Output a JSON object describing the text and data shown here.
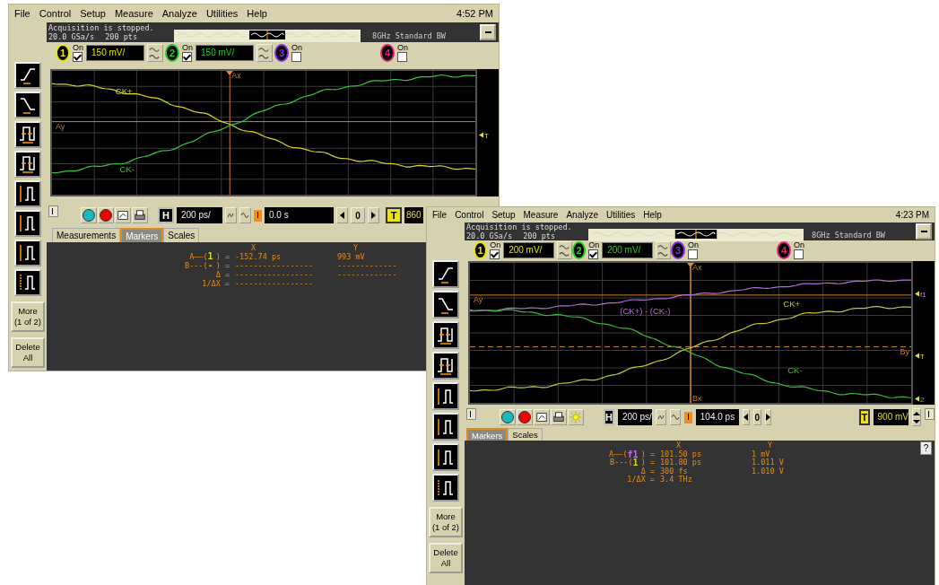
{
  "windows": [
    {
      "menu": [
        "File",
        "Control",
        "Setup",
        "Measure",
        "Analyze",
        "Utilities",
        "Help"
      ],
      "clock": "4:52 PM",
      "status": {
        "message": "Acquisition is stopped.",
        "rate": "20.0 GSa/s",
        "points": "200 pts",
        "bandwidth": "8GHz Standard BW"
      },
      "channels": [
        {
          "number": "1",
          "color": "#e6e600",
          "on_label": "On",
          "checked": true,
          "scale": "150 mV/"
        },
        {
          "number": "2",
          "color": "#22cc22",
          "on_label": "On",
          "checked": true,
          "scale": "150 mV/"
        },
        {
          "number": "3",
          "color": "#8a2be2",
          "on_label": "On",
          "checked": false
        },
        {
          "number": "4",
          "color": "#e0207a",
          "on_label": "On",
          "checked": false
        }
      ],
      "sidebar": {
        "more": "More (1 of 2)",
        "delete": "Delete All"
      },
      "plot": {
        "traces": [
          {
            "label": "CK+",
            "color": "#d8d820"
          },
          {
            "label": "CK-",
            "color": "#3cc83c"
          }
        ],
        "cursors": [
          {
            "label": "Ax",
            "kind": "ax"
          },
          {
            "label": "Ay",
            "kind": "ay"
          }
        ],
        "edge_labels": [
          {
            "text": "T",
            "kind": "trigger"
          }
        ]
      },
      "toolbar": {
        "tools": [
          {
            "kind": "run"
          },
          {
            "kind": "stop"
          },
          {
            "kind": "image"
          },
          {
            "kind": "print"
          }
        ],
        "horizontal": "H",
        "timebase": "200 ps/",
        "delay": "0.0 s",
        "reference": "0",
        "trigger": "T",
        "trigger_level": "860"
      },
      "tabs": [
        {
          "label": "Measurements",
          "selected": false
        },
        {
          "label": "Markers",
          "selected": true
        },
        {
          "label": "Scales",
          "selected": false
        }
      ],
      "readout": {
        "x_header": "X",
        "y_header": "Y",
        "rows": [
          {
            "prefix": "A——(",
            "source": "1",
            "suffix": ") =",
            "color": "#d8d820",
            "x": "-152.74 ps",
            "y": "993 mV"
          },
          {
            "prefix": "B---(",
            "source": "-",
            "suffix": ") =",
            "x": "-----------------",
            "y": "-------------"
          },
          {
            "prefix": "Δ =",
            "x": "-----------------",
            "y": "-------------"
          },
          {
            "prefix": "1/ΔX =",
            "x": "-----------------"
          }
        ]
      }
    },
    {
      "menu": [
        "File",
        "Control",
        "Setup",
        "Measure",
        "Analyze",
        "Utilities",
        "Help"
      ],
      "clock": "4:23 PM",
      "status": {
        "message": "Acquisition is stopped.",
        "rate": "20.0 GSa/s",
        "points": "200 pts",
        "bandwidth": "8GHz Standard BW"
      },
      "channels": [
        {
          "number": "1",
          "color": "#e6e600",
          "on_label": "On",
          "checked": true,
          "scale": "200 mV/"
        },
        {
          "number": "2",
          "color": "#22cc22",
          "on_label": "On",
          "checked": true,
          "scale": "200 mV/"
        },
        {
          "number": "3",
          "color": "#8a2be2",
          "on_label": "On",
          "checked": false
        },
        {
          "number": "4",
          "color": "#e0207a",
          "on_label": "On",
          "checked": false
        }
      ],
      "sidebar": {
        "more": "More (1 of 2)",
        "delete": "Delete All"
      },
      "plot": {
        "traces": [
          {
            "label": "(CK+) - (CK-)",
            "color": "#b070d8"
          },
          {
            "label": "CK+",
            "color": "#c8c830"
          },
          {
            "label": "CK-",
            "color": "#3cb83c"
          }
        ],
        "cursors": [
          {
            "label": "Ax",
            "kind": "ax"
          },
          {
            "label": "Ay",
            "kind": "ay"
          },
          {
            "label": "By",
            "kind": "by"
          },
          {
            "label": "Bx",
            "kind": "bx"
          }
        ],
        "edge_labels": [
          {
            "text": "f1",
            "kind": "function"
          },
          {
            "text": "T",
            "kind": "trigger"
          },
          {
            "text": "2",
            "kind": "channel"
          }
        ]
      },
      "toolbar": {
        "tools": [
          {
            "kind": "run"
          },
          {
            "kind": "stop"
          },
          {
            "kind": "image"
          },
          {
            "kind": "print"
          },
          {
            "kind": "brightness"
          }
        ],
        "horizontal": "H",
        "timebase": "200 ps/",
        "delay": "104.0 ps",
        "reference": "0",
        "trigger": "T",
        "trigger_level": "900 mV",
        "spinner": true
      },
      "tabs": [
        {
          "label": "Markers",
          "selected": true
        },
        {
          "label": "Scales",
          "selected": false
        }
      ],
      "help": "?",
      "readout": {
        "x_header": "X",
        "y_header": "Y",
        "rows": [
          {
            "prefix": "A——(",
            "source": "f1",
            "suffix": ") =",
            "color": "#c070e0",
            "x": "101.50 ps",
            "y": "1 mV"
          },
          {
            "prefix": "B---(",
            "source": "1",
            "suffix": ") =",
            "color": "#d8d820",
            "x": "101.80 ps",
            "y": "1.011 V"
          },
          {
            "prefix": "Δ =",
            "x": "300 fs",
            "y": "1.010 V"
          },
          {
            "prefix": "1/ΔX =",
            "x": "3.4 THz"
          }
        ]
      }
    }
  ]
}
